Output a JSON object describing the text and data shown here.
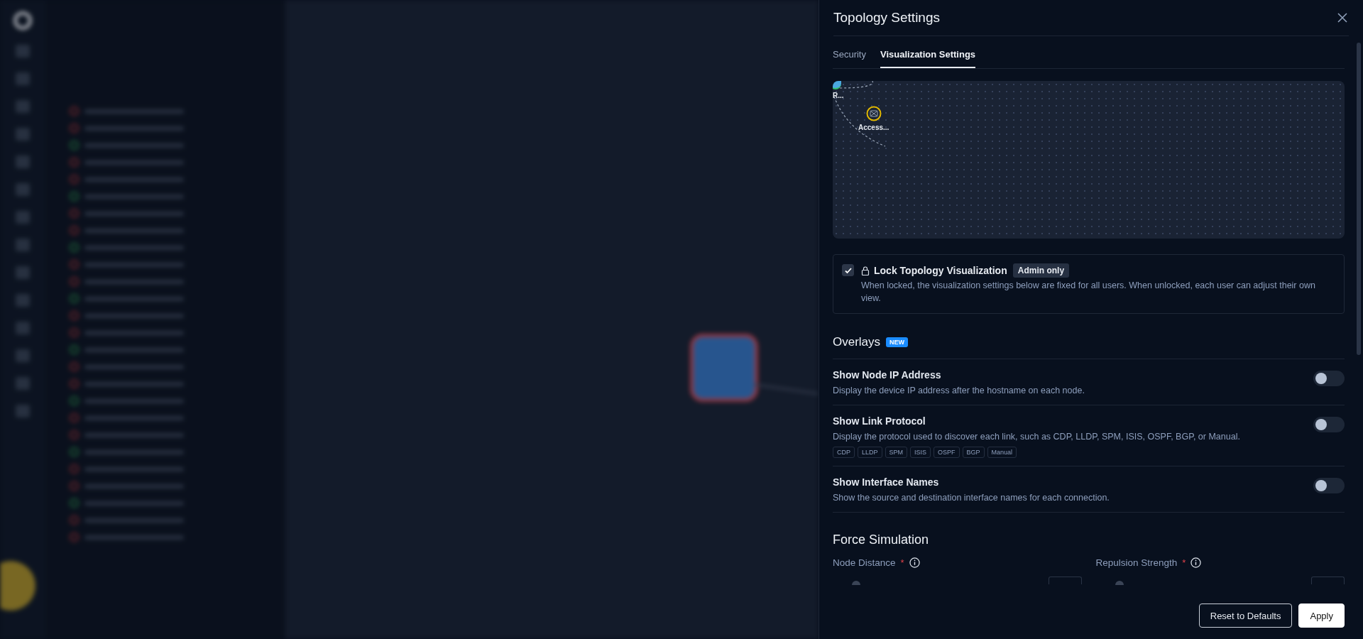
{
  "drawer": {
    "title": "Topology Settings"
  },
  "tabs": [
    {
      "label": "Security",
      "selected": false
    },
    {
      "label": "Visualization Settings",
      "selected": true
    }
  ],
  "preview": {
    "nodes": [
      {
        "label": "R...",
        "kind": "router"
      },
      {
        "label": "Access...",
        "kind": "switch"
      }
    ]
  },
  "lock": {
    "title": "Lock Topology Visualization",
    "checked": true,
    "badge": "Admin only",
    "description": "When locked, the visualization settings below are fixed for all users. When unlocked, each user can adjust their own view."
  },
  "overlays": {
    "title": "Overlays",
    "badge": "NEW",
    "items": [
      {
        "title": "Show Node IP Address",
        "description": "Display the device IP address after the hostname on each node.",
        "on": false
      },
      {
        "title": "Show Link Protocol",
        "description": "Display the protocol used to discover each link, such as CDP, LLDP, SPM, ISIS, OSPF, BGP, or Manual.",
        "on": false,
        "tags": [
          "CDP",
          "LLDP",
          "SPM",
          "ISIS",
          "OSPF",
          "BGP",
          "Manual"
        ]
      },
      {
        "title": "Show Interface Names",
        "description": "Show the source and destination interface names for each connection.",
        "on": false
      }
    ]
  },
  "force": {
    "title": "Force Simulation",
    "fields": [
      {
        "label": "Node Distance",
        "required": true,
        "required_mark": "*"
      },
      {
        "label": "Repulsion Strength",
        "required": true,
        "required_mark": "*"
      }
    ]
  },
  "buttons": [
    {
      "label": "Reset to Defaults",
      "kind": "secondary"
    },
    {
      "label": "Apply",
      "kind": "primary"
    }
  ]
}
